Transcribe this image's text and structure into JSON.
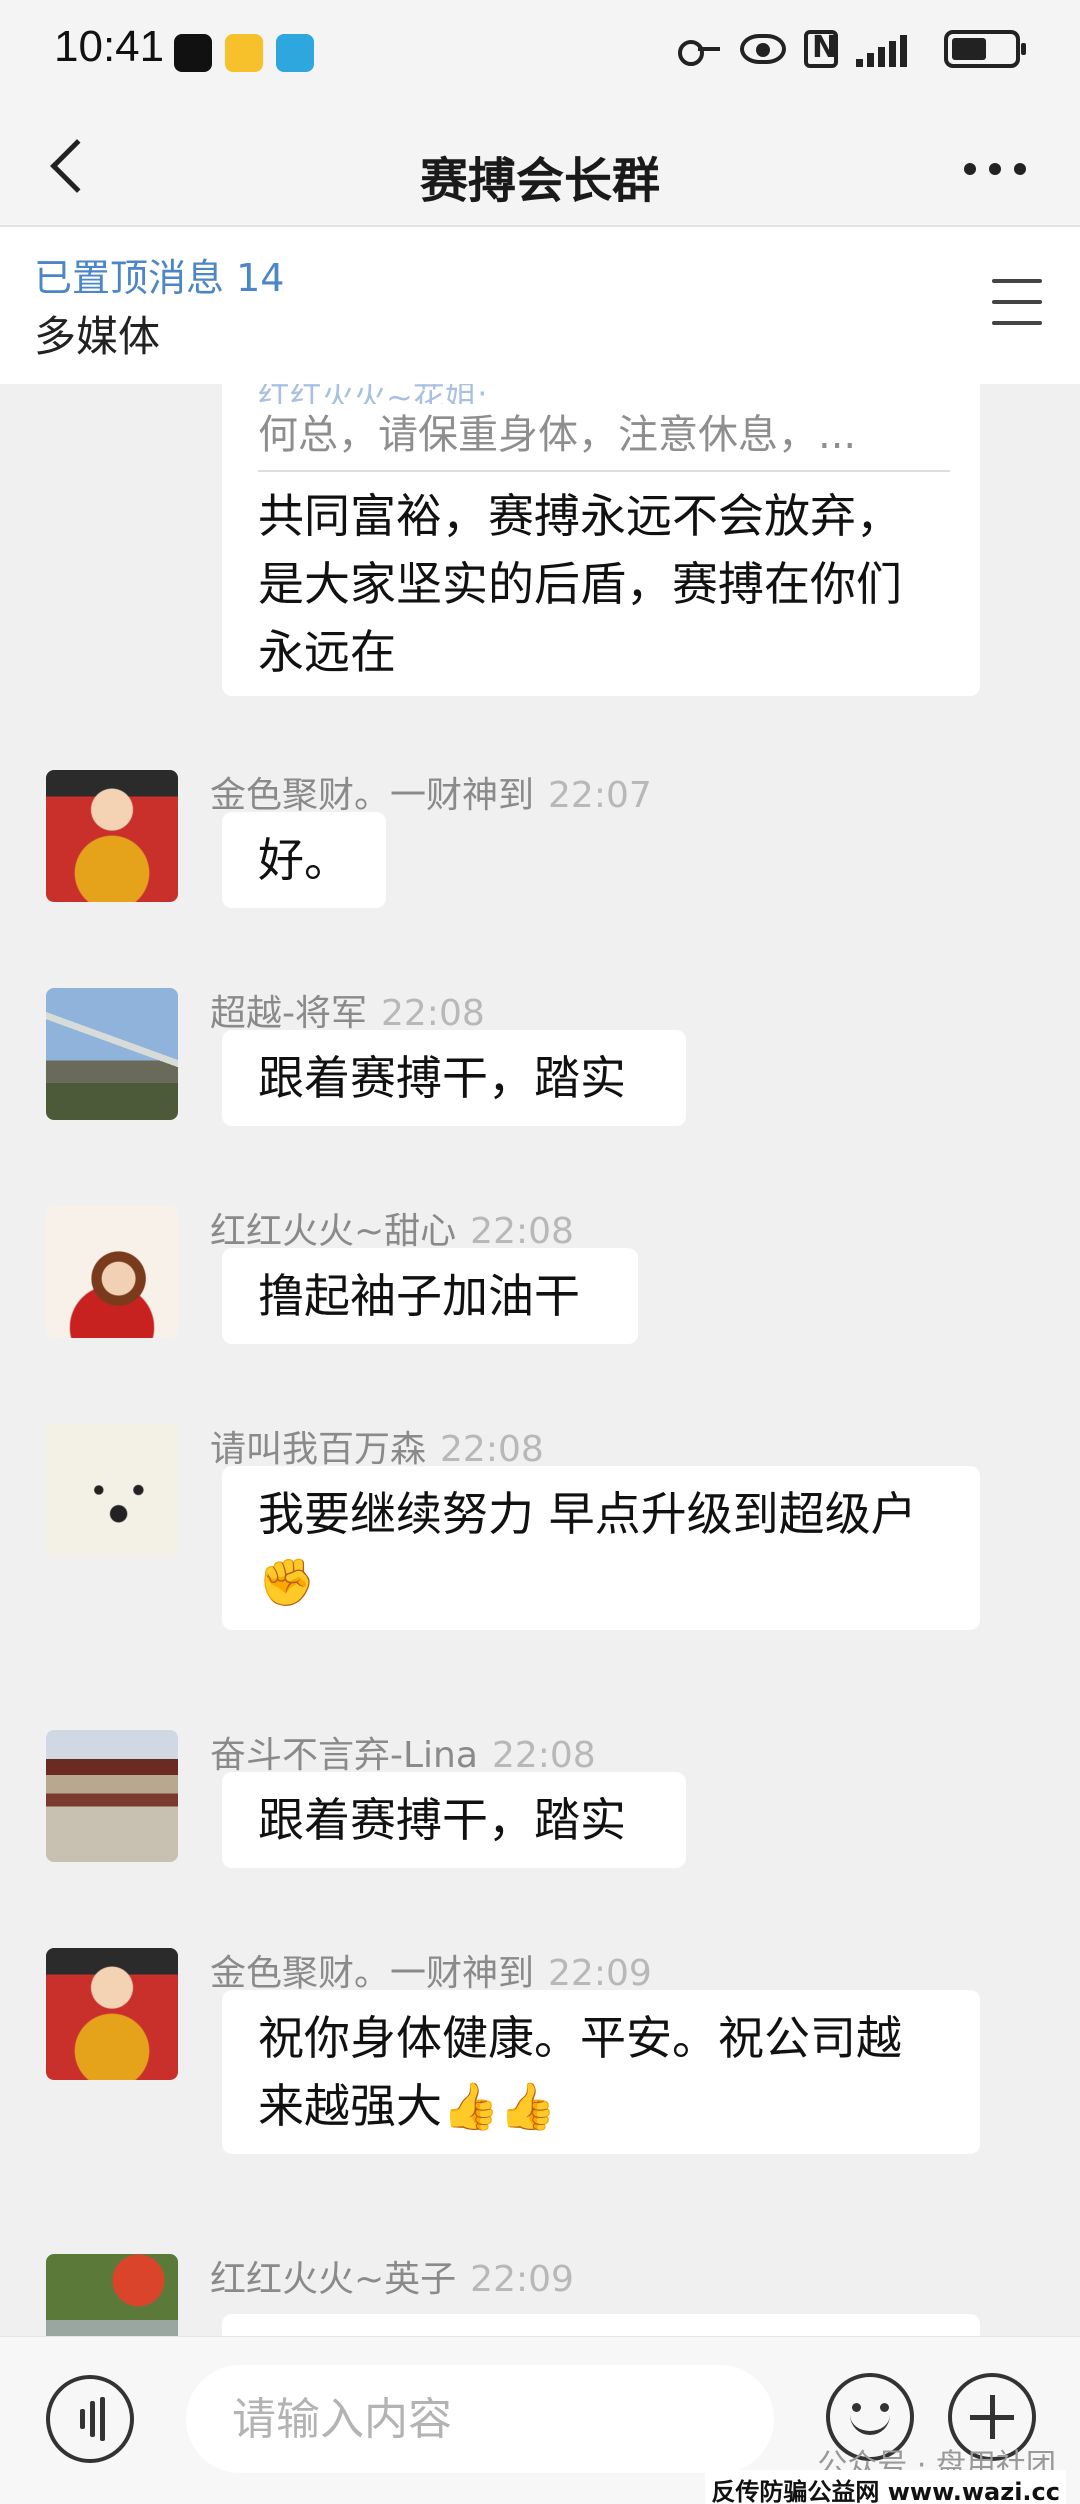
{
  "status_bar": {
    "time": "10:41",
    "icons": [
      "app-icon-black",
      "mail-icon",
      "telegram-icon",
      "key-icon",
      "eye-icon",
      "nfc-icon",
      "signal-icon",
      "battery-icon"
    ]
  },
  "header": {
    "title": "赛搏会长群",
    "back_icon": "back-arrow-icon",
    "more_icon": "more-dots-icon"
  },
  "pinned": {
    "title": "已置顶消息 14",
    "subtitle": "多媒体",
    "menu_icon": "menu-icon"
  },
  "quote": {
    "sender": "红红火火~花姐:",
    "quoted_text": "何总，请保重身体，注意休息，...",
    "reply_text": "共同富裕，赛搏永远不会放弃，是大家坚实的后盾，赛搏在你们永远在"
  },
  "messages": [
    {
      "sender": "金色聚财。一财神到",
      "time": "22:07",
      "text": "好。"
    },
    {
      "sender": "超越-将军",
      "time": "22:08",
      "text": "跟着赛搏干，踏实"
    },
    {
      "sender": "红红火火~甜心",
      "time": "22:08",
      "text": "撸起袖子加油干"
    },
    {
      "sender": "请叫我百万森",
      "time": "22:08",
      "text": "我要继续努力 早点升级到超级户 ✊"
    },
    {
      "sender": "奋斗不言弃-Lina",
      "time": "22:08",
      "text": "跟着赛搏干，踏实"
    },
    {
      "sender": "金色聚财。一财神到",
      "time": "22:09",
      "text": "祝你身体健康。平安。祝公司越来越强大👍👍"
    },
    {
      "sender": "红红火火~英子",
      "time": "22:09",
      "text": ""
    }
  ],
  "input_bar": {
    "placeholder": "请输入内容",
    "voice_icon": "voice-icon",
    "emoji_icon": "emoji-icon",
    "plus_icon": "plus-icon"
  },
  "watermark": {
    "line1": "公众号 · 盘用社团",
    "line2": "反传防骗公益网 www.wazi.cc"
  },
  "colors": {
    "accent": "#4b86c8",
    "bubble": "#ffffff",
    "background": "#f0f0f0",
    "meta_text": "#8a8a8a"
  }
}
